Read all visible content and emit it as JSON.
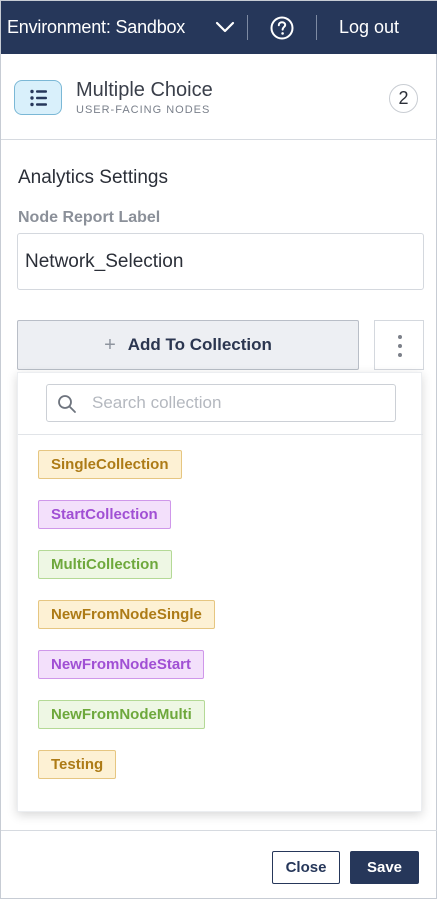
{
  "topbar": {
    "environment_label": "Environment: Sandbox",
    "logout_label": "Log out",
    "background": "#26375a"
  },
  "node": {
    "title": "Multiple Choice",
    "subtitle": "USER-FACING NODES",
    "badge": "2"
  },
  "analytics": {
    "section_title": "Analytics Settings",
    "report_label": "Node Report Label",
    "report_value": "Network_Selection"
  },
  "collection": {
    "add_label": "Add To Collection",
    "search_placeholder": "Search collection",
    "tags": [
      {
        "label": "SingleCollection",
        "kind": "single"
      },
      {
        "label": "StartCollection",
        "kind": "start"
      },
      {
        "label": "MultiCollection",
        "kind": "multi"
      },
      {
        "label": "NewFromNodeSingle",
        "kind": "single"
      },
      {
        "label": "NewFromNodeStart",
        "kind": "start"
      },
      {
        "label": "NewFromNodeMulti",
        "kind": "multi"
      },
      {
        "label": "Testing",
        "kind": "single"
      }
    ]
  },
  "footer": {
    "close_label": "Close",
    "save_label": "Save"
  },
  "colors": {
    "accent": "#26375a",
    "single_tag": "#ad7b16",
    "start_tag": "#a04fd4",
    "multi_tag": "#6ea83c"
  }
}
